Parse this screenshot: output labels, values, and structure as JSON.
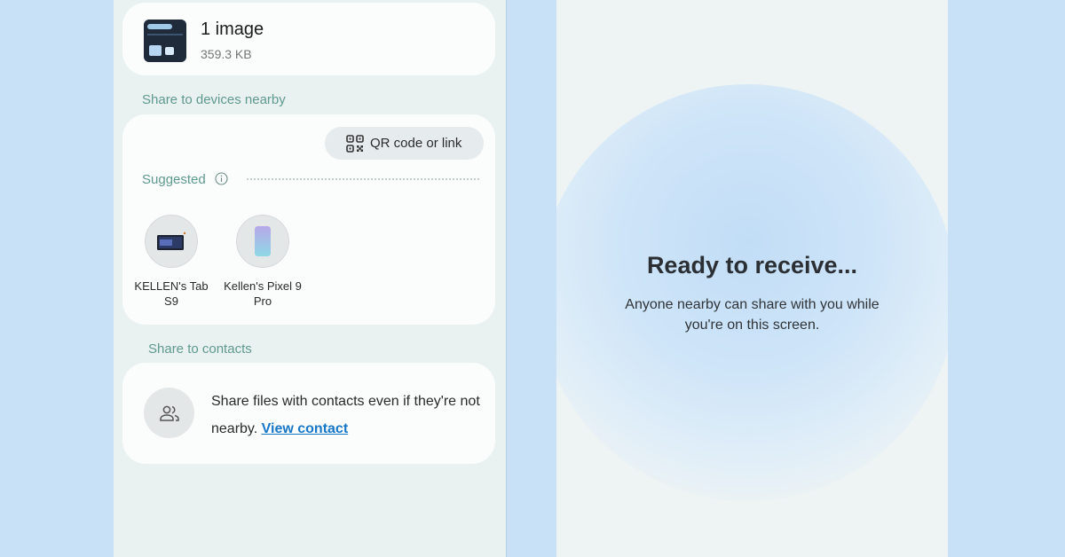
{
  "share_sheet": {
    "file": {
      "title": "1 image",
      "size": "359.3 KB"
    },
    "nearby": {
      "section_label": "Share to devices nearby",
      "qr_button_label": "QR code or link",
      "suggested_label": "Suggested",
      "devices": [
        {
          "name": "KELLEN's Tab S9",
          "icon": "tablet-icon"
        },
        {
          "name": "Kellen's Pixel 9 Pro",
          "icon": "phone-icon"
        }
      ]
    },
    "contacts": {
      "section_label": "Share to contacts",
      "description": "Share files with contacts even if they're not nearby.",
      "link_label": "View contact"
    }
  },
  "receive_screen": {
    "title": "Ready to receive...",
    "subtitle": "Anyone nearby can share with you while you're on this screen."
  },
  "colors": {
    "background": "#c9e1f6",
    "accent_label": "#5f9a8e",
    "link": "#1677c8"
  }
}
